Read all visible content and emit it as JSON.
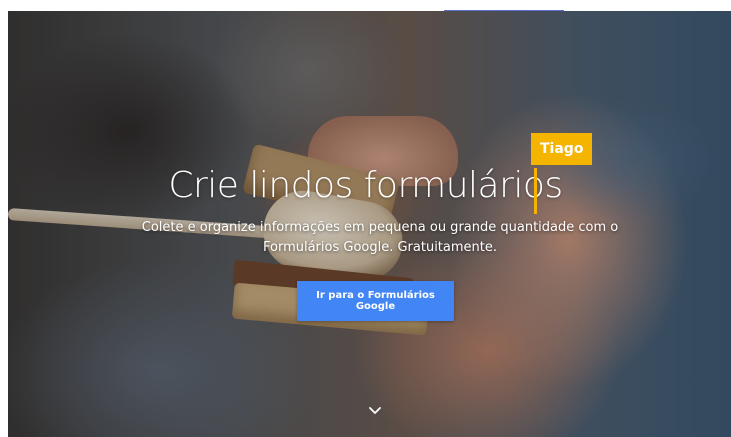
{
  "hero": {
    "headline": "Crie lindos formulários",
    "subtitle": "Colete e organize informações em pequena ou grande quantidade com o Formulários Google. Gratuitamente.",
    "cta_label": "Ir para o Formulários Google",
    "scroll_icon": "chevron-down-icon"
  },
  "collaborator": {
    "name": "Tiago",
    "color": "#f4b400"
  },
  "colors": {
    "button": "#4285f4"
  }
}
